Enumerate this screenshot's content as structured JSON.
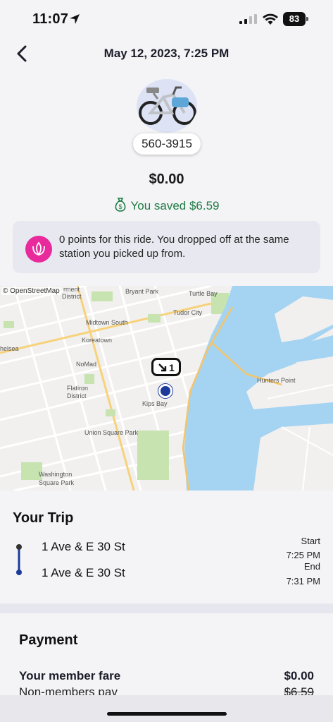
{
  "status_bar": {
    "time": "11:07",
    "battery": "83"
  },
  "header": {
    "title": "May 12, 2023, 7:25 PM"
  },
  "bike": {
    "id": "560-3915"
  },
  "fare": {
    "amount": "$0.00",
    "saved_text": "You saved $6.59"
  },
  "points_banner": {
    "text": "0 points for this ride. You dropped off at the same station you picked up from."
  },
  "map": {
    "attribution": "© OpenStreetMap",
    "station_marker_count": "1",
    "labels": [
      "rment",
      "District",
      "Bryant Park",
      "Turtle Bay",
      "Midtown South",
      "Tudor City",
      "Koreatown",
      "helsea",
      "NoMad",
      "Hunters Point",
      "Flatiron",
      "District",
      "Kips Bay",
      "Union Square Park",
      "Washington",
      "Square Park"
    ]
  },
  "trip": {
    "heading": "Your Trip",
    "start_station": "1 Ave & E 30 St",
    "end_station": "1 Ave & E 30 St",
    "start_label": "Start",
    "start_time": "7:25 PM",
    "end_label": "End",
    "end_time": "7:31 PM"
  },
  "payment": {
    "heading": "Payment",
    "member_fare_label": "Your member fare",
    "member_fare_value": "$0.00",
    "nonmember_label": "Non-members pay",
    "nonmember_value": "$6.59"
  },
  "colors": {
    "accent_pink": "#e82a9c",
    "saved_green": "#1e7b45",
    "route_blue": "#1c3a9a",
    "water": "#a5d4f2"
  }
}
